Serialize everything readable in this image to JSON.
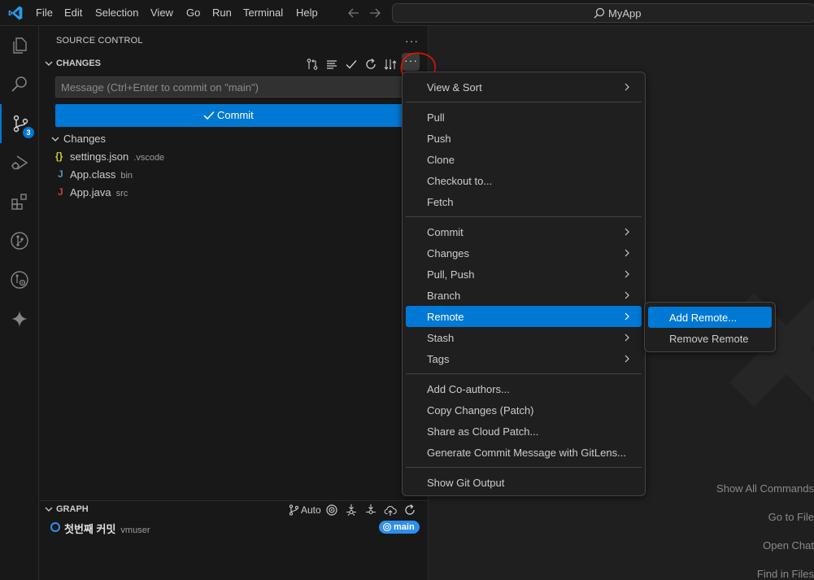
{
  "titlebar": {
    "menus": [
      "File",
      "Edit",
      "Selection",
      "View",
      "Go",
      "Run",
      "Terminal",
      "Help"
    ],
    "search_text": "MyApp"
  },
  "activitybar": {
    "items": [
      "explorer-icon",
      "search-icon",
      "source-control-icon",
      "run-debug-icon",
      "extensions-icon",
      "git-graph-icon",
      "remote-explorer-icon",
      "copilot-icon"
    ],
    "scm_badge": "3",
    "accent": "#0078d4"
  },
  "sidebar": {
    "title": "SOURCE CONTROL",
    "changes_header": "CHANGES",
    "message_placeholder": "Message (Ctrl+Enter to commit on \"main\")",
    "commit_label": "Commit",
    "changes_group": "Changes",
    "files": [
      {
        "name": "settings.json",
        "dir": ".vscode",
        "icon": "{}",
        "color": "#cbcb41"
      },
      {
        "name": "App.class",
        "dir": "bin",
        "icon": "J",
        "color": "#519aba"
      },
      {
        "name": "App.java",
        "dir": "src",
        "icon": "J",
        "color": "#cc3e44"
      }
    ],
    "graph": {
      "header": "GRAPH",
      "auto_label": "Auto",
      "commit_message": "첫번째 커밋",
      "commit_author": "vmuser",
      "branch": "main"
    }
  },
  "context_menu": {
    "items": [
      {
        "label": "View & Sort",
        "submenu": true
      },
      {
        "label": "Pull"
      },
      {
        "label": "Push"
      },
      {
        "label": "Clone"
      },
      {
        "label": "Checkout to..."
      },
      {
        "label": "Fetch"
      },
      {
        "label": "Commit",
        "submenu": true
      },
      {
        "label": "Changes",
        "submenu": true
      },
      {
        "label": "Pull, Push",
        "submenu": true
      },
      {
        "label": "Branch",
        "submenu": true
      },
      {
        "label": "Remote",
        "submenu": true,
        "highlighted": true
      },
      {
        "label": "Stash",
        "submenu": true
      },
      {
        "label": "Tags",
        "submenu": true
      },
      {
        "label": "Add Co-authors..."
      },
      {
        "label": "Copy Changes (Patch)"
      },
      {
        "label": "Share as Cloud Patch..."
      },
      {
        "label": "Generate Commit Message with GitLens..."
      },
      {
        "label": "Show Git Output"
      }
    ],
    "remote_submenu": [
      {
        "label": "Add Remote...",
        "highlighted": true
      },
      {
        "label": "Remove Remote"
      }
    ]
  },
  "editor": {
    "hints": [
      "Show All Commands",
      "Go to File",
      "Open Chat",
      "Find in Files"
    ]
  }
}
